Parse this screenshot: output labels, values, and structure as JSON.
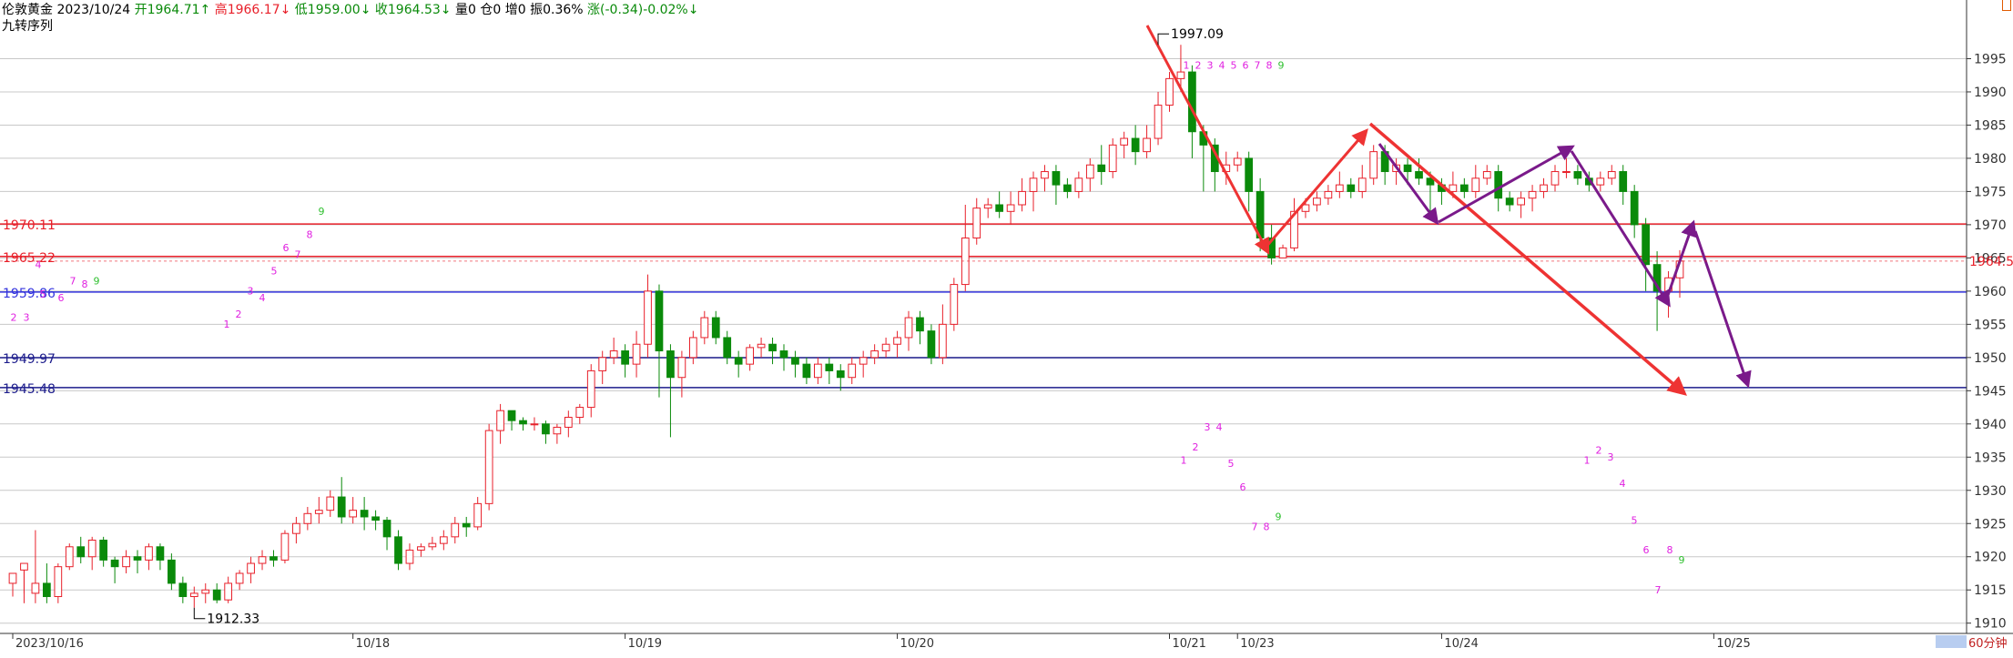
{
  "header": {
    "symbol": "伦敦黄金",
    "date": "2023/10/24",
    "open_label": "开1964.71",
    "open_arrow": "↑",
    "high_label": "高1966.17",
    "high_arrow": "↓",
    "low_label": "低1959.00",
    "low_arrow": "↓",
    "close_label": "收1964.53",
    "close_arrow": "↓",
    "volume": "量0",
    "position": "仓0",
    "increase": "增0",
    "amplitude": "振0.36%",
    "change": "涨(-0.34)-0.02%",
    "change_arrow": "↓"
  },
  "indicator_title": "九转序列",
  "timeframe": "60分钟",
  "colors": {
    "up": "#e8202a",
    "down": "#0a8a0a",
    "purple": "#7a1a8a",
    "red_arrow": "#ee3333",
    "blue_line": "#3333dd",
    "navy_line": "#1c1c8c",
    "magenta": "#e020e0",
    "green9": "#30c030",
    "grid": "#c8c8c8"
  },
  "chart_data": {
    "type": "candlestick",
    "ylim": [
      1909,
      2000
    ],
    "y_ticks": [
      1910,
      1915,
      1920,
      1925,
      1930,
      1935,
      1940,
      1945,
      1950,
      1955,
      1960,
      1965,
      1970,
      1975,
      1980,
      1985,
      1990,
      1995
    ],
    "x_tick_labels": [
      {
        "label": "2023/10/16",
        "index": 0
      },
      {
        "label": "10/18",
        "index": 30
      },
      {
        "label": "10/19",
        "index": 54
      },
      {
        "label": "10/20",
        "index": 78
      },
      {
        "label": "10/21",
        "index": 102
      },
      {
        "label": "10/23",
        "index": 108
      },
      {
        "label": "10/24",
        "index": 126
      },
      {
        "label": "10/25",
        "index": 150
      }
    ],
    "price_lines": [
      {
        "label": "1970.11",
        "value": 1970.11,
        "color": "#e8202a"
      },
      {
        "label": "1965.22",
        "value": 1965.22,
        "color": "#e8202a"
      },
      {
        "label": "1959.86",
        "value": 1959.86,
        "color": "#3333dd"
      },
      {
        "label": "1949.97",
        "value": 1949.97,
        "color": "#1c1c8c"
      },
      {
        "label": "1945.48",
        "value": 1945.48,
        "color": "#1c1c8c"
      }
    ],
    "last_price": "1964.53",
    "annotations": [
      {
        "text": "1997.09",
        "index": 101,
        "value": 1997.09,
        "type": "high"
      },
      {
        "text": "1912.33",
        "index": 16,
        "value": 1912.33,
        "type": "low"
      }
    ],
    "candles": [
      [
        1916,
        1917.5,
        1915,
        1914
      ],
      [
        1918,
        1919,
        1913,
        1914.5
      ],
      [
        1914.5,
        1916,
        1924,
        1913
      ],
      [
        1916,
        1914,
        1919,
        1913
      ],
      [
        1914,
        1918.5,
        1919,
        1913
      ],
      [
        1918.5,
        1921.5,
        1922,
        1918
      ],
      [
        1921.5,
        1920,
        1923,
        1919
      ],
      [
        1920,
        1922.5,
        1923,
        1918
      ],
      [
        1922.5,
        1919.5,
        1923,
        1918.5
      ],
      [
        1919.5,
        1918.5,
        1920,
        1916
      ],
      [
        1918.5,
        1920,
        1921,
        1917.5
      ],
      [
        1920,
        1919.5,
        1921,
        1917.5
      ],
      [
        1919.5,
        1921.5,
        1922,
        1918
      ],
      [
        1921.5,
        1919.5,
        1922,
        1918
      ],
      [
        1919.5,
        1916,
        1920.5,
        1915
      ],
      [
        1916,
        1914,
        1917,
        1913
      ],
      [
        1914,
        1914.5,
        1915.5,
        1912.33
      ],
      [
        1914.5,
        1915,
        1916,
        1913
      ],
      [
        1915,
        1913.5,
        1916,
        1913
      ],
      [
        1913.5,
        1916,
        1917,
        1913
      ],
      [
        1916,
        1917.5,
        1918,
        1915
      ],
      [
        1917.5,
        1919,
        1920,
        1916
      ],
      [
        1919,
        1920,
        1921,
        1918
      ],
      [
        1920,
        1919.5,
        1921,
        1918.5
      ],
      [
        1919.5,
        1923.5,
        1924,
        1919
      ],
      [
        1923.5,
        1925,
        1926,
        1922
      ],
      [
        1925,
        1926.5,
        1927.5,
        1924
      ],
      [
        1926.5,
        1927,
        1929,
        1925
      ],
      [
        1927,
        1929,
        1930,
        1926
      ],
      [
        1929,
        1926,
        1932,
        1925
      ],
      [
        1926,
        1927,
        1929,
        1925
      ],
      [
        1927,
        1926,
        1929,
        1924
      ],
      [
        1926,
        1925.5,
        1927,
        1924
      ],
      [
        1925.5,
        1923,
        1926,
        1921
      ],
      [
        1923,
        1919,
        1924,
        1918
      ],
      [
        1919,
        1921,
        1922,
        1918
      ],
      [
        1921,
        1921.5,
        1922,
        1920
      ],
      [
        1921.5,
        1922,
        1923,
        1921
      ],
      [
        1922,
        1923,
        1924,
        1921
      ],
      [
        1923,
        1925,
        1926,
        1922
      ],
      [
        1925,
        1924.5,
        1926,
        1923
      ],
      [
        1924.5,
        1928,
        1929,
        1924
      ],
      [
        1928,
        1939,
        1940,
        1927
      ],
      [
        1939,
        1942,
        1943,
        1937
      ],
      [
        1942,
        1940.5,
        1942,
        1939
      ],
      [
        1940.5,
        1940,
        1941,
        1939
      ],
      [
        1940,
        1940,
        1941,
        1939
      ],
      [
        1940,
        1938.5,
        1940.5,
        1937
      ],
      [
        1938.5,
        1939.5,
        1940,
        1937
      ],
      [
        1939.5,
        1941,
        1942,
        1938
      ],
      [
        1941,
        1942.5,
        1943,
        1940
      ],
      [
        1942.5,
        1948,
        1949,
        1941
      ],
      [
        1948,
        1950,
        1951,
        1946
      ],
      [
        1950,
        1951,
        1953,
        1949
      ],
      [
        1951,
        1949,
        1952,
        1947
      ],
      [
        1949,
        1952,
        1954,
        1947
      ],
      [
        1952,
        1960,
        1962.5,
        1950
      ],
      [
        1960,
        1951,
        1961,
        1944
      ],
      [
        1951,
        1947,
        1952,
        1938
      ],
      [
        1947,
        1950,
        1951,
        1944
      ],
      [
        1950,
        1953,
        1954,
        1949
      ],
      [
        1953,
        1956,
        1957,
        1952
      ],
      [
        1956,
        1953,
        1957,
        1952
      ],
      [
        1953,
        1950,
        1954,
        1949
      ],
      [
        1950,
        1949,
        1951,
        1947
      ],
      [
        1949,
        1951.5,
        1952,
        1948
      ],
      [
        1951.5,
        1952,
        1953,
        1950
      ],
      [
        1952,
        1951,
        1953,
        1949
      ],
      [
        1951,
        1950,
        1952,
        1948
      ],
      [
        1950,
        1949,
        1951,
        1947
      ],
      [
        1949,
        1947,
        1950,
        1946
      ],
      [
        1947,
        1949,
        1950,
        1946
      ],
      [
        1949,
        1948,
        1950,
        1946
      ],
      [
        1948,
        1947,
        1949,
        1945
      ],
      [
        1947,
        1949,
        1950,
        1946
      ],
      [
        1949,
        1950,
        1951,
        1947
      ],
      [
        1950,
        1951,
        1952,
        1949
      ],
      [
        1951,
        1952,
        1953,
        1950
      ],
      [
        1952,
        1953,
        1954,
        1950
      ],
      [
        1953,
        1956,
        1957,
        1951
      ],
      [
        1956,
        1954,
        1957,
        1952
      ],
      [
        1954,
        1950,
        1955,
        1949
      ],
      [
        1950,
        1955,
        1958,
        1949
      ],
      [
        1955,
        1961,
        1962,
        1954
      ],
      [
        1961,
        1968,
        1973,
        1960
      ],
      [
        1968,
        1972.5,
        1974,
        1967
      ],
      [
        1972.5,
        1973,
        1974,
        1971
      ],
      [
        1973,
        1972,
        1975,
        1971
      ],
      [
        1972,
        1973,
        1975,
        1970
      ],
      [
        1973,
        1975,
        1977,
        1972
      ],
      [
        1975,
        1977,
        1978,
        1972
      ],
      [
        1977,
        1978,
        1979,
        1975
      ],
      [
        1978,
        1976,
        1979,
        1973
      ],
      [
        1976,
        1975,
        1977,
        1974
      ],
      [
        1975,
        1977,
        1978,
        1974
      ],
      [
        1977,
        1979,
        1980,
        1975
      ],
      [
        1979,
        1978,
        1982,
        1976
      ],
      [
        1978,
        1982,
        1983,
        1977
      ],
      [
        1982,
        1983,
        1984,
        1980
      ],
      [
        1983,
        1981,
        1985,
        1979
      ],
      [
        1981,
        1983,
        1985,
        1980
      ],
      [
        1983,
        1988,
        1990,
        1982
      ],
      [
        1988,
        1992,
        1993,
        1987
      ],
      [
        1992,
        1993,
        1997.09,
        1990
      ],
      [
        1993,
        1984,
        1994,
        1980
      ],
      [
        1984,
        1982,
        1985,
        1975
      ],
      [
        1982,
        1978,
        1983,
        1975
      ],
      [
        1978,
        1979,
        1981,
        1976
      ],
      [
        1979,
        1980,
        1981,
        1978
      ],
      [
        1980,
        1975,
        1981,
        1972
      ],
      [
        1975,
        1968,
        1977,
        1966
      ],
      [
        1968,
        1965,
        1970,
        1964
      ],
      [
        1965,
        1966.5,
        1967,
        1965
      ],
      [
        1966.5,
        1972,
        1974,
        1966
      ],
      [
        1972,
        1973,
        1974,
        1971
      ],
      [
        1973,
        1974,
        1975,
        1972
      ],
      [
        1974,
        1975,
        1976,
        1973
      ],
      [
        1975,
        1976,
        1978,
        1974
      ],
      [
        1976,
        1975,
        1977,
        1974
      ],
      [
        1975,
        1977,
        1979,
        1974
      ],
      [
        1977,
        1981,
        1982,
        1976
      ],
      [
        1981,
        1978,
        1982,
        1976
      ],
      [
        1978,
        1979,
        1980,
        1976
      ],
      [
        1979,
        1978,
        1980,
        1976
      ],
      [
        1978,
        1977,
        1980,
        1976
      ],
      [
        1977,
        1976,
        1978,
        1971
      ],
      [
        1976,
        1975,
        1977,
        1973
      ],
      [
        1975,
        1976,
        1978,
        1974
      ],
      [
        1976,
        1975,
        1977,
        1974
      ],
      [
        1975,
        1977,
        1979,
        1974
      ],
      [
        1977,
        1978,
        1979,
        1976
      ],
      [
        1978,
        1974,
        1979,
        1972
      ],
      [
        1974,
        1973,
        1975,
        1972
      ],
      [
        1973,
        1974,
        1975,
        1971
      ],
      [
        1974,
        1975,
        1976,
        1972
      ],
      [
        1975,
        1976,
        1977,
        1974
      ],
      [
        1976,
        1978,
        1979,
        1975
      ],
      [
        1978,
        1978,
        1980,
        1977
      ],
      [
        1978,
        1977,
        1979,
        1976
      ],
      [
        1977,
        1976,
        1978,
        1975
      ],
      [
        1976,
        1977,
        1978,
        1975
      ],
      [
        1977,
        1978,
        1979,
        1976
      ],
      [
        1978,
        1975,
        1979,
        1973
      ],
      [
        1975,
        1970,
        1976,
        1968
      ],
      [
        1970,
        1964,
        1971,
        1960
      ],
      [
        1964,
        1960,
        1966,
        1954
      ],
      [
        1960,
        1962,
        1963,
        1956
      ],
      [
        1962,
        1964.53,
        1966.17,
        1959
      ]
    ],
    "td_sequences": [
      {
        "color": "magenta",
        "points": [
          {
            "t": "2",
            "x": 15,
            "v": 1955.5
          },
          {
            "t": "3",
            "x": 29,
            "v": 1955.5
          },
          {
            "t": "4",
            "x": 42,
            "v": 1963.5
          },
          {
            "t": "5",
            "x": 47,
            "v": 1959
          },
          {
            "t": "6",
            "x": 67,
            "v": 1958.5
          },
          {
            "t": "7",
            "x": 80,
            "v": 1961
          },
          {
            "t": "8",
            "x": 93,
            "v": 1960.5
          },
          {
            "t": "1",
            "x": 249,
            "v": 1954.5
          },
          {
            "t": "2",
            "x": 262,
            "v": 1956
          },
          {
            "t": "3",
            "x": 275,
            "v": 1959.5
          },
          {
            "t": "4",
            "x": 288,
            "v": 1958.5
          },
          {
            "t": "5",
            "x": 301,
            "v": 1962.5
          },
          {
            "t": "6",
            "x": 314,
            "v": 1966
          },
          {
            "t": "7",
            "x": 327,
            "v": 1965
          },
          {
            "t": "8",
            "x": 340,
            "v": 1968
          },
          {
            "t": "1",
            "x": 1303,
            "v": 1993.5
          },
          {
            "t": "2",
            "x": 1316,
            "v": 1993.5
          },
          {
            "t": "3",
            "x": 1329,
            "v": 1993.5
          },
          {
            "t": "4",
            "x": 1342,
            "v": 1993.5
          },
          {
            "t": "5",
            "x": 1355,
            "v": 1993.5
          },
          {
            "t": "6",
            "x": 1368,
            "v": 1993.5
          },
          {
            "t": "7",
            "x": 1381,
            "v": 1993.5
          },
          {
            "t": "8",
            "x": 1394,
            "v": 1993.5
          },
          {
            "t": "1",
            "x": 1300,
            "v": 1934
          },
          {
            "t": "2",
            "x": 1313,
            "v": 1936
          },
          {
            "t": "3",
            "x": 1326,
            "v": 1939
          },
          {
            "t": "4",
            "x": 1339,
            "v": 1939
          },
          {
            "t": "5",
            "x": 1352,
            "v": 1933.5
          },
          {
            "t": "6",
            "x": 1365,
            "v": 1930
          },
          {
            "t": "7",
            "x": 1378,
            "v": 1924
          },
          {
            "t": "8",
            "x": 1391,
            "v": 1924
          },
          {
            "t": "1",
            "x": 1743,
            "v": 1934
          },
          {
            "t": "2",
            "x": 1756,
            "v": 1935.5
          },
          {
            "t": "3",
            "x": 1769,
            "v": 1934.5
          },
          {
            "t": "4",
            "x": 1782,
            "v": 1930.5
          },
          {
            "t": "5",
            "x": 1795,
            "v": 1925
          },
          {
            "t": "6",
            "x": 1808,
            "v": 1920.5
          },
          {
            "t": "7",
            "x": 1821,
            "v": 1914.5
          },
          {
            "t": "8",
            "x": 1834,
            "v": 1920.5
          }
        ]
      },
      {
        "color": "green",
        "points": [
          {
            "t": "9",
            "x": 106,
            "v": 1961
          },
          {
            "t": "9",
            "x": 353,
            "v": 1971.5
          },
          {
            "t": "9",
            "x": 1407,
            "v": 1993.5
          },
          {
            "t": "9",
            "x": 1404,
            "v": 1925.5
          },
          {
            "t": "9",
            "x": 1847,
            "v": 1919
          }
        ]
      }
    ]
  }
}
